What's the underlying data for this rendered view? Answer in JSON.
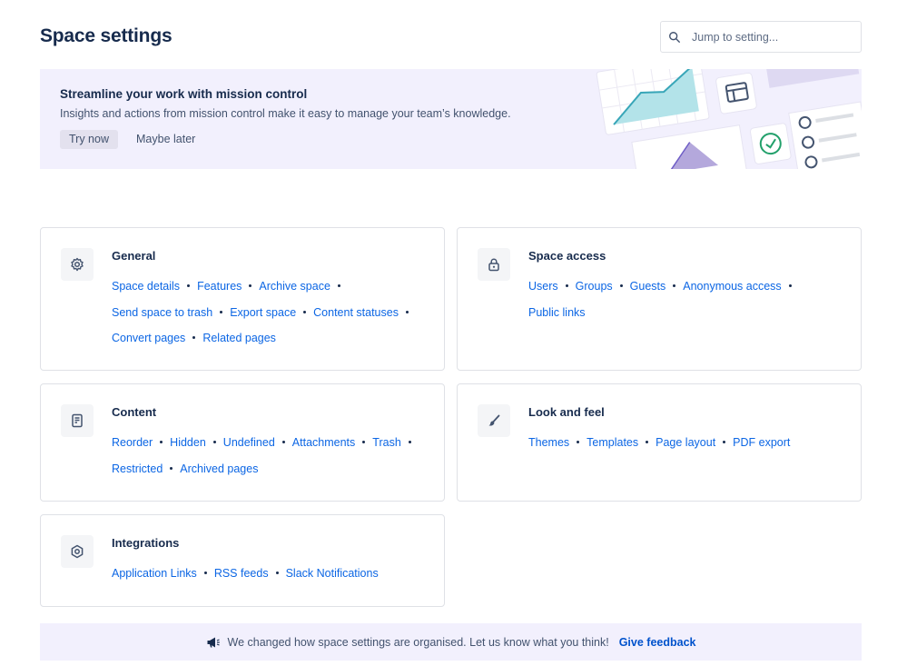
{
  "header": {
    "title": "Space settings",
    "search_placeholder": "Jump to setting..."
  },
  "banner": {
    "title": "Streamline your work with mission control",
    "description": "Insights and actions from mission control make it easy to manage your team’s knowledge.",
    "primary_label": "Try now",
    "secondary_label": "Maybe later"
  },
  "cards": {
    "general": {
      "title": "General",
      "icon": "gear-icon",
      "links": [
        "Space details",
        "Features",
        "Archive space",
        "Send space to trash",
        "Export space",
        "Content statuses",
        "Convert pages",
        "Related pages"
      ]
    },
    "access": {
      "title": "Space access",
      "icon": "lock-icon",
      "links": [
        "Users",
        "Groups",
        "Guests",
        "Anonymous access",
        "Public links"
      ]
    },
    "content": {
      "title": "Content",
      "icon": "page-icon",
      "links": [
        "Reorder",
        "Hidden",
        "Undefined",
        "Attachments",
        "Trash",
        "Restricted",
        "Archived pages"
      ]
    },
    "look": {
      "title": "Look and feel",
      "icon": "paintbrush-icon",
      "links": [
        "Themes",
        "Templates",
        "Page layout",
        "PDF export"
      ]
    },
    "integrations": {
      "title": "Integrations",
      "icon": "hexagon-icon",
      "links": [
        "Application Links",
        "RSS feeds",
        "Slack Notifications"
      ]
    }
  },
  "feedback": {
    "icon": "megaphone-icon",
    "message": "We changed how space settings are organised. Let us know what you think!",
    "link_label": "Give feedback"
  },
  "colors": {
    "link": "#0c66e4",
    "banner_bg": "#f2f0fd",
    "text": "#172b4d"
  }
}
